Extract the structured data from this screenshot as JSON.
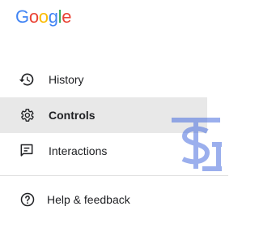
{
  "brand": {
    "letters": [
      {
        "ch": "G",
        "color": "#4285F4"
      },
      {
        "ch": "o",
        "color": "#EA4335"
      },
      {
        "ch": "o",
        "color": "#FBBC05"
      },
      {
        "ch": "g",
        "color": "#4285F4"
      },
      {
        "ch": "l",
        "color": "#34A853"
      },
      {
        "ch": "e",
        "color": "#EA4335"
      }
    ]
  },
  "nav": {
    "items": [
      {
        "label": "History",
        "icon": "history-icon",
        "selected": false
      },
      {
        "label": "Controls",
        "icon": "gear-icon",
        "selected": true
      },
      {
        "label": "Interactions",
        "icon": "feedback-icon",
        "selected": false
      }
    ]
  },
  "footer": {
    "help_label": "Help & feedback",
    "help_icon": "help-circle-icon"
  },
  "colors": {
    "selected_bg": "#e8e8e8",
    "text": "#202124",
    "watermark": "#4a6fe0"
  }
}
